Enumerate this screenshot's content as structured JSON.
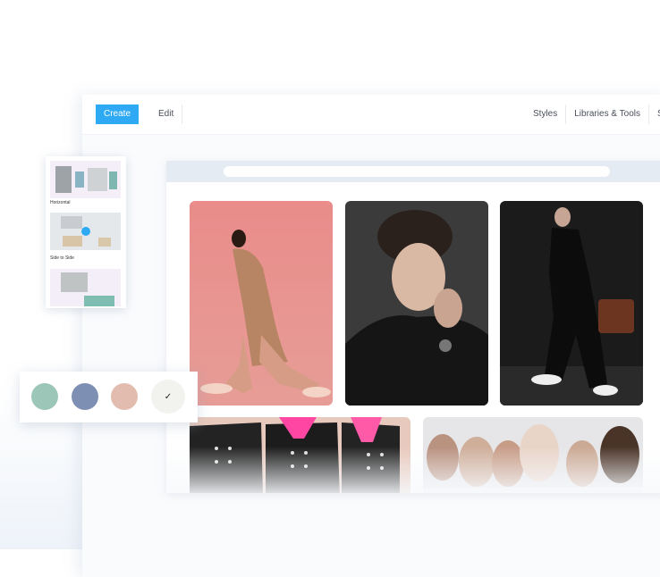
{
  "toolbar": {
    "create_label": "Create",
    "edit_label": "Edit",
    "right_items": [
      "Styles",
      "Libraries & Tools",
      "Se"
    ]
  },
  "layout_options": [
    {
      "label": "Horizontal"
    },
    {
      "label": "Side to Side",
      "selected": true
    },
    {
      "label": ""
    }
  ],
  "palette": {
    "swatches": [
      "#9cc6b7",
      "#7d8fb3",
      "#e2bcae",
      "#f2f2ee"
    ],
    "selected_index": 3,
    "check_mark": "✓"
  },
  "gallery": {
    "photos": [
      {
        "name": "photo-camel-coat-pink"
      },
      {
        "name": "photo-curly-hair-portrait"
      },
      {
        "name": "photo-leather-suit-walk"
      },
      {
        "name": "photo-black-jackets-pink-bows"
      },
      {
        "name": "photo-group-portrait-white"
      }
    ]
  },
  "colors": {
    "accent": "#2ea9f3"
  }
}
